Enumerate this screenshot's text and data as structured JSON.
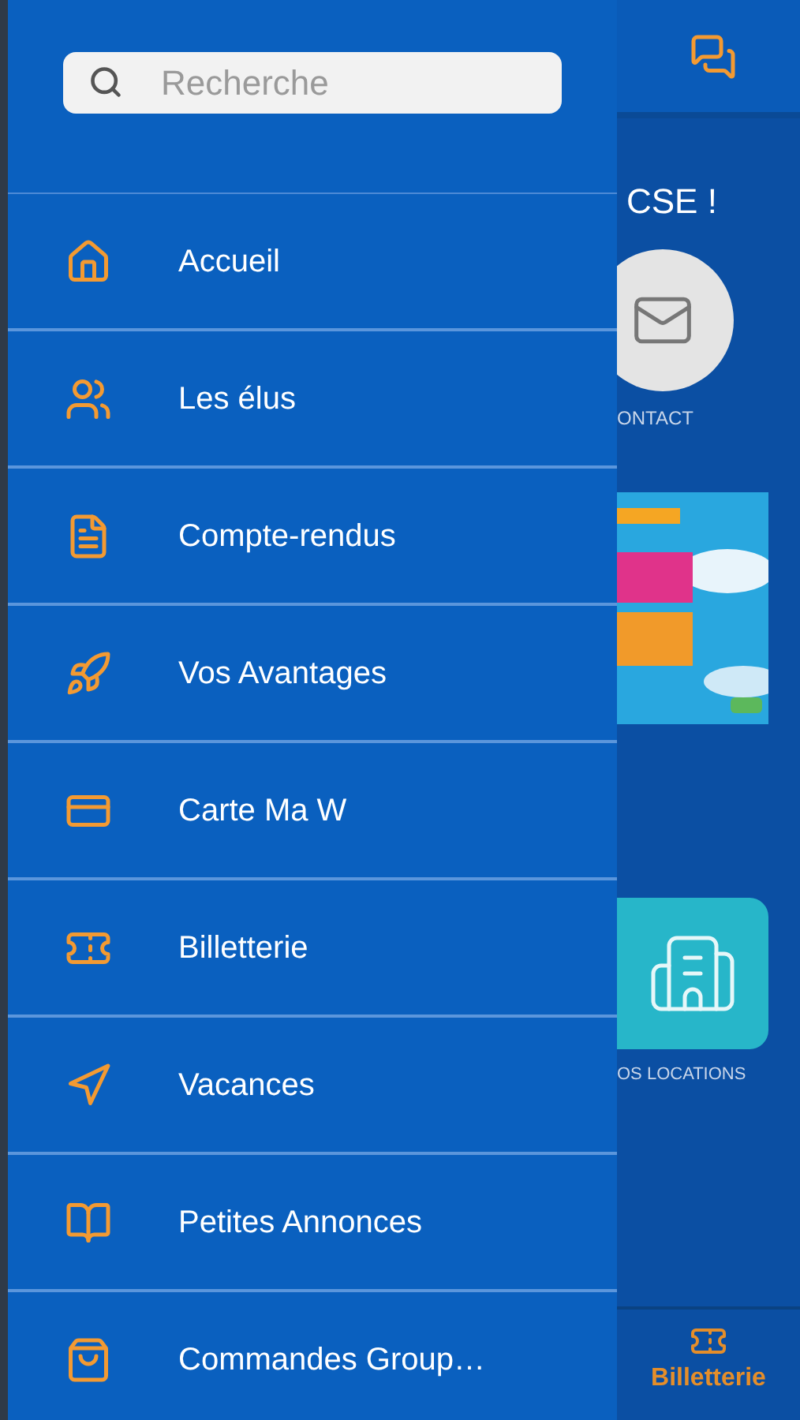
{
  "drawer": {
    "search": {
      "placeholder": "Recherche"
    },
    "items": [
      {
        "label": "Accueil"
      },
      {
        "label": "Les élus"
      },
      {
        "label": "Compte-rendus"
      },
      {
        "label": "Vos Avantages"
      },
      {
        "label": "Carte Ma W"
      },
      {
        "label": "Billetterie"
      },
      {
        "label": "Vacances"
      },
      {
        "label": "Petites Annonces"
      },
      {
        "label": "Commandes Group…"
      }
    ]
  },
  "background_page": {
    "heading": "CSE !",
    "contact_label": "ONTACT",
    "locations_label": "OS LOCATIONS",
    "bottom_tab": {
      "label": "Billetterie"
    }
  }
}
